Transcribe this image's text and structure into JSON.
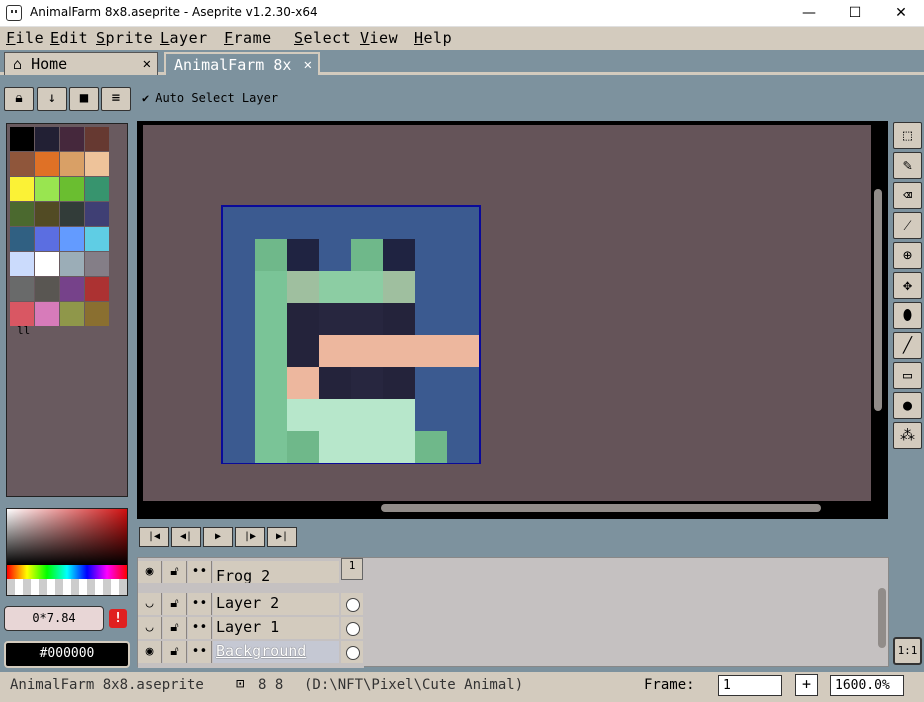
{
  "window": {
    "title": "AnimalFarm 8x8.aseprite - Aseprite v1.2.30-x64",
    "minimize": "—",
    "maximize": "☐",
    "close": "✕"
  },
  "menu": [
    "File",
    "Edit",
    "Sprite",
    "Layer",
    "Frame",
    "Select",
    "View",
    "Help"
  ],
  "tabs": {
    "home": "Home",
    "file": "AnimalFarm 8x",
    "close_glyph": "✕"
  },
  "context_bar": {
    "auto_select_label": "Auto Select Layer",
    "auto_select_checked": true
  },
  "palette": {
    "colors": [
      "#000000",
      "#222034",
      "#45283c",
      "#663931",
      "#8f563b",
      "#df7126",
      "#d9a066",
      "#eec39a",
      "#fbf236",
      "#99e550",
      "#6abe30",
      "#37946e",
      "#4b692f",
      "#524b24",
      "#323c39",
      "#3f3f74",
      "#306082",
      "#5b6ee1",
      "#639bff",
      "#5fcde4",
      "#cbdbfc",
      "#ffffff",
      "#9badb7",
      "#847e87",
      "#696a6a",
      "#595652",
      "#76428a",
      "#ac3232",
      "#d95763",
      "#d77bba",
      "#8f974a",
      "#8a6f30"
    ],
    "extra_glyph": "ll"
  },
  "color_panel": {
    "position": "0*7.84",
    "hex": "#000000",
    "warning_glyph": "!"
  },
  "sprite": {
    "pixels": [
      [
        "#3b5a90",
        "#3b5a90",
        "#3b5a90",
        "#3b5a90",
        "#3b5a90",
        "#3b5a90",
        "#3b5a90",
        "#3b5a90"
      ],
      [
        "#3b5a90",
        "#6fb88a",
        "#1f2341",
        "#3b5a90",
        "#6fb88a",
        "#1f2341",
        "#3b5a90",
        "#3b5a90"
      ],
      [
        "#3b5a90",
        "#7ac497",
        "#9fbf9f",
        "#8ccda3",
        "#8ccda3",
        "#9fbf9f",
        "#3b5a90",
        "#3b5a90"
      ],
      [
        "#3b5a90",
        "#7ac497",
        "#24233b",
        "#27263f",
        "#27263f",
        "#24233b",
        "#3b5a90",
        "#3b5a90"
      ],
      [
        "#3b5a90",
        "#7ac497",
        "#24233b",
        "#edb79e",
        "#edb79e",
        "#edb79e",
        "#edb79e",
        "#edb79e"
      ],
      [
        "#3b5a90",
        "#7ac497",
        "#edb79e",
        "#24233b",
        "#27263f",
        "#24233b",
        "#3b5a90",
        "#3b5a90"
      ],
      [
        "#3b5a90",
        "#7ac497",
        "#b7e7cb",
        "#b7e7cb",
        "#b7e7cb",
        "#b7e7cb",
        "#3b5a90",
        "#3b5a90"
      ],
      [
        "#3b5a90",
        "#7ac497",
        "#6fb88a",
        "#b7e7cb",
        "#b7e7cb",
        "#b7e7cb",
        "#6fb88a",
        "#3b5a90"
      ]
    ]
  },
  "tools": [
    "marquee-icon",
    "pencil-icon",
    "eraser-icon",
    "eyedropper-icon",
    "zoom-icon",
    "move-icon",
    "fill-icon",
    "line-icon",
    "rectangle-icon",
    "contour-icon",
    "blur-icon"
  ],
  "tool_glyphs": [
    "⬚",
    "✎",
    "⌫",
    "⁄",
    "⊕",
    "✥",
    "⬮",
    "╱",
    "▭",
    "●",
    "⁂"
  ],
  "ratio_label": "1:1",
  "playback": {
    "first": "|◀",
    "prev": "◀|",
    "play": "▶",
    "next": "|▶",
    "last": "▶|"
  },
  "timeline": {
    "frame_number": "1",
    "layers": [
      {
        "name": "Frog 2",
        "visible_glyph": "◉",
        "lock_glyph": "🔓",
        "cont_glyph": "••"
      },
      {
        "name": "Layer 2",
        "visible_glyph": "◡",
        "lock_glyph": "🔓",
        "cont_glyph": "••"
      },
      {
        "name": "Layer 1",
        "visible_glyph": "◡",
        "lock_glyph": "🔓",
        "cont_glyph": "••"
      },
      {
        "name": "Background",
        "visible_glyph": "◉",
        "lock_glyph": "🔓",
        "cont_glyph": "••"
      }
    ]
  },
  "status": {
    "filename": "AnimalFarm 8x8.aseprite",
    "size": "8 8",
    "path": "(D:\\NFT\\Pixel\\Cute Animal)",
    "frame_label": "Frame:",
    "frame_value": "1",
    "add_glyph": "+",
    "zoom": "1600.0%"
  }
}
